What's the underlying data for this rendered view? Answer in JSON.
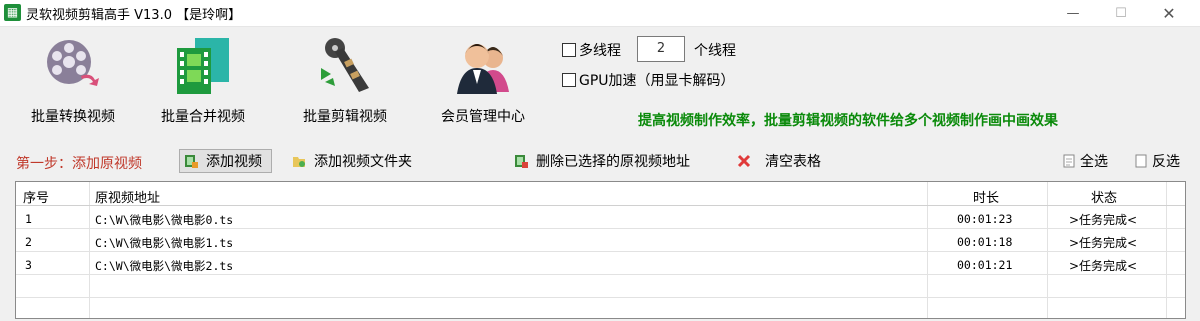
{
  "window": {
    "app_icon_glyph": "▦",
    "title": "灵软视频剪辑高手 V13.0 【是玲啊】",
    "min_glyph": "—",
    "max_glyph": "☐",
    "close_glyph": "✕"
  },
  "toolbar": [
    {
      "label": "批量转换视频",
      "icon": "film-reel-icon"
    },
    {
      "label": "批量合并视频",
      "icon": "merge-film-icon"
    },
    {
      "label": "批量剪辑视频",
      "icon": "film-strip-icon"
    },
    {
      "label": "会员管理中心",
      "icon": "users-icon"
    }
  ],
  "options": {
    "multithread_label": "多线程",
    "thread_count": "2",
    "thread_unit": "个线程",
    "gpu_label": "GPU加速（用显卡解码）"
  },
  "promo_text": "提高视频制作效率，批量剪辑视频的软件给多个视频制作画中画效果",
  "actions": {
    "step_label": "第一步：添加原视频",
    "add_video": "添加视频",
    "add_folder": "添加视频文件夹",
    "delete_selected": "删除已选择的原视频地址",
    "clear_table": "清空表格",
    "select_all": "全选",
    "invert_select": "反选"
  },
  "table": {
    "headers": {
      "index": "序号",
      "path": "原视频地址",
      "duration": "时长",
      "status": "状态"
    },
    "rows": [
      {
        "index": "1",
        "path": "C:\\W\\微电影\\微电影0.ts",
        "duration": "00:01:23",
        "status": ">任务完成<"
      },
      {
        "index": "2",
        "path": "C:\\W\\微电影\\微电影1.ts",
        "duration": "00:01:18",
        "status": ">任务完成<"
      },
      {
        "index": "3",
        "path": "C:\\W\\微电影\\微电影2.ts",
        "duration": "00:01:21",
        "status": ">任务完成<"
      }
    ]
  },
  "colors": {
    "step": "#c0392b",
    "promo": "#0a8a0a",
    "app_icon": "#1e8f3a"
  }
}
